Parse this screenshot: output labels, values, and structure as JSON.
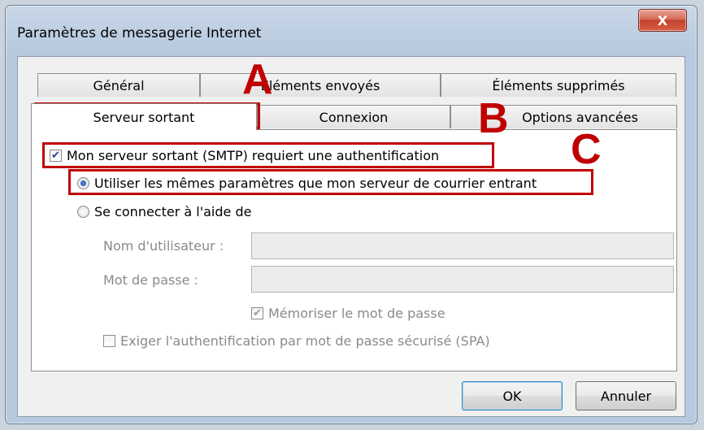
{
  "window": {
    "title": "Paramètres de messagerie Internet",
    "close_label": "X"
  },
  "tabs": {
    "row1": [
      "Général",
      "Éléments envoyés",
      "Éléments supprimés"
    ],
    "row2": [
      "Serveur sortant",
      "Connexion",
      "Options avancées"
    ],
    "active": "Serveur sortant"
  },
  "annotations": {
    "A": "A",
    "B": "B",
    "C": "C",
    "color": "#c00000"
  },
  "options": {
    "smtp_auth": {
      "label": "Mon serveur sortant (SMTP) requiert une authentification",
      "checked": true
    },
    "same_settings": {
      "label": "Utiliser les mêmes paramètres que mon serveur de courrier entrant",
      "selected": true
    },
    "connect_with": {
      "label": "Se connecter à l'aide de",
      "selected": false
    },
    "username_label": "Nom d'utilisateur :",
    "username_value": "",
    "password_label": "Mot de passe :",
    "password_value": "",
    "remember_password": {
      "label": "Mémoriser le mot de passe",
      "checked": true,
      "enabled": false
    },
    "spa": {
      "label": "Exiger l'authentification par mot de passe sécurisé (SPA)",
      "checked": false,
      "enabled": false
    }
  },
  "buttons": {
    "ok": "OK",
    "cancel": "Annuler"
  }
}
